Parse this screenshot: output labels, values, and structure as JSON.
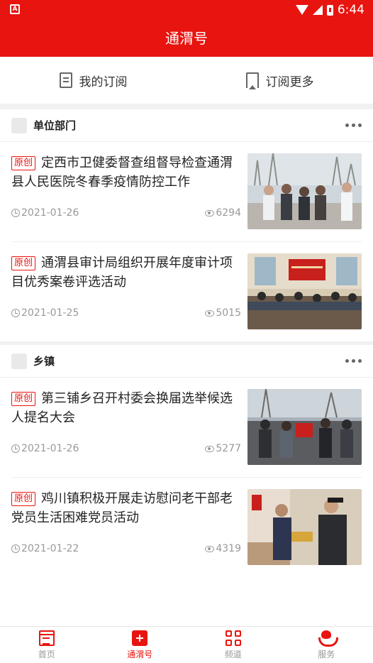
{
  "status_bar": {
    "time": "6:44"
  },
  "header": {
    "title": "通渭号"
  },
  "sub_actions": {
    "my_subscriptions": "我的订阅",
    "subscribe_more": "订阅更多"
  },
  "sections": [
    {
      "name": "单位部门",
      "articles": [
        {
          "tag": "原创",
          "title": "定西市卫健委督查组督导检查通渭县人民医院冬春季疫情防控工作",
          "date": "2021-01-26",
          "views": "6294"
        },
        {
          "tag": "原创",
          "title": "通渭县审计局组织开展年度审计项目优秀案卷评选活动",
          "date": "2021-01-25",
          "views": "5015"
        }
      ]
    },
    {
      "name": "乡镇",
      "articles": [
        {
          "tag": "原创",
          "title": "第三铺乡召开村委会换届选举候选人提名大会",
          "date": "2021-01-26",
          "views": "5277"
        },
        {
          "tag": "原创",
          "title": "鸡川镇积极开展走访慰问老干部老党员生活困难党员活动",
          "date": "2021-01-22",
          "views": "4319"
        }
      ]
    }
  ],
  "tabbar": {
    "home": "首页",
    "tongwei": "通渭号",
    "channels": "频道",
    "services": "服务"
  },
  "colors": {
    "brand": "#e8140f",
    "muted": "#999999"
  }
}
